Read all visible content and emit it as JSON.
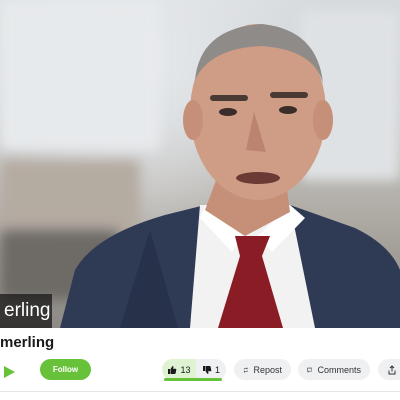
{
  "video": {
    "speaker_name_fragment": "erling"
  },
  "post": {
    "title": "merling"
  },
  "actions": {
    "follow_label": "Follow",
    "upvotes": "13",
    "downvotes": "1",
    "repost_label": "Repost",
    "comments_label": "Comments"
  },
  "colors": {
    "accent": "#67c23a",
    "pill_bg": "#eef0f2"
  }
}
